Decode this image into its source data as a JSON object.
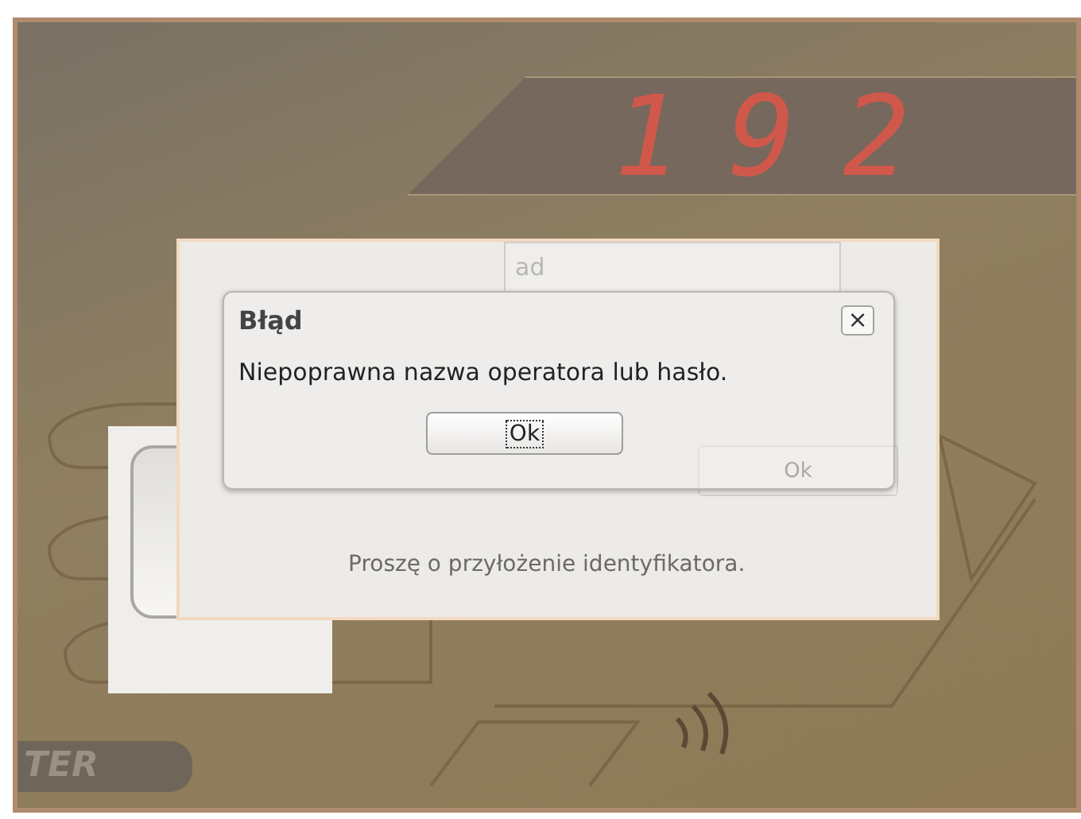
{
  "display": {
    "reading": "192"
  },
  "brand": {
    "text": "TER"
  },
  "login_panel": {
    "operator_value": "ad",
    "ok_button": "Ok",
    "message": "Proszę o przyłożenie identyfikatora."
  },
  "dialog": {
    "title": "Błąd",
    "close": "×",
    "message": "Niepoprawna nazwa operatora lub hasło.",
    "buttons": [
      {
        "label": "Ok",
        "focused": true
      }
    ]
  }
}
